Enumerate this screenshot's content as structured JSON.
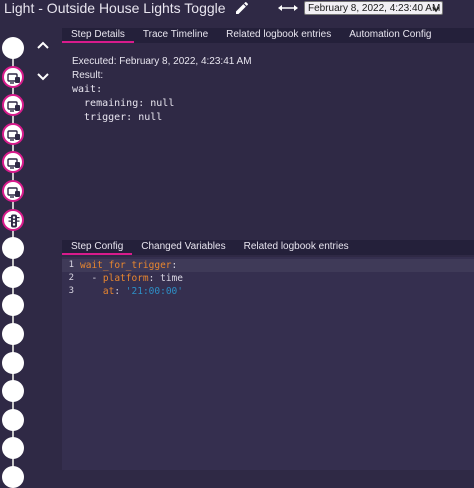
{
  "header": {
    "title": "Light - Outside House Lights Toggle",
    "time_selected": "February 8, 2022, 4:23:40 AM"
  },
  "timeline": {
    "nodes": [
      {
        "kind": "plain"
      },
      {
        "kind": "service"
      },
      {
        "kind": "service"
      },
      {
        "kind": "service"
      },
      {
        "kind": "service"
      },
      {
        "kind": "service"
      },
      {
        "kind": "traffic"
      },
      {
        "kind": "plain"
      },
      {
        "kind": "plain"
      },
      {
        "kind": "plain"
      },
      {
        "kind": "plain"
      },
      {
        "kind": "plain"
      },
      {
        "kind": "plain"
      },
      {
        "kind": "plain"
      },
      {
        "kind": "plain"
      },
      {
        "kind": "plain"
      }
    ]
  },
  "top_tabs": [
    "Step Details",
    "Trace Timeline",
    "Related logbook entries",
    "Automation Config"
  ],
  "details": {
    "executed": "Executed: February 8, 2022, 4:23:41 AM",
    "result_label": "Result:",
    "yaml_lines": [
      "wait:",
      "  remaining: null",
      "  trigger: null"
    ]
  },
  "bottom_tabs": [
    "Step Config",
    "Changed Variables",
    "Related logbook entries"
  ],
  "config": {
    "line_numbers": [
      "1",
      "2",
      "3"
    ],
    "l1_key": "wait_for_trigger",
    "l1_colon": ":",
    "l2_dash": "  - ",
    "l2_key": "platform",
    "l2_colon": ": ",
    "l2_val": "time",
    "l3_indent": "    ",
    "l3_key": "at",
    "l3_colon": ": ",
    "l3_val": "'21:00:00'"
  },
  "colors": {
    "accent": "#d81b8c",
    "background": "#2f2945",
    "yaml_key": "#e8862f",
    "yaml_string": "#2d8fc7"
  }
}
